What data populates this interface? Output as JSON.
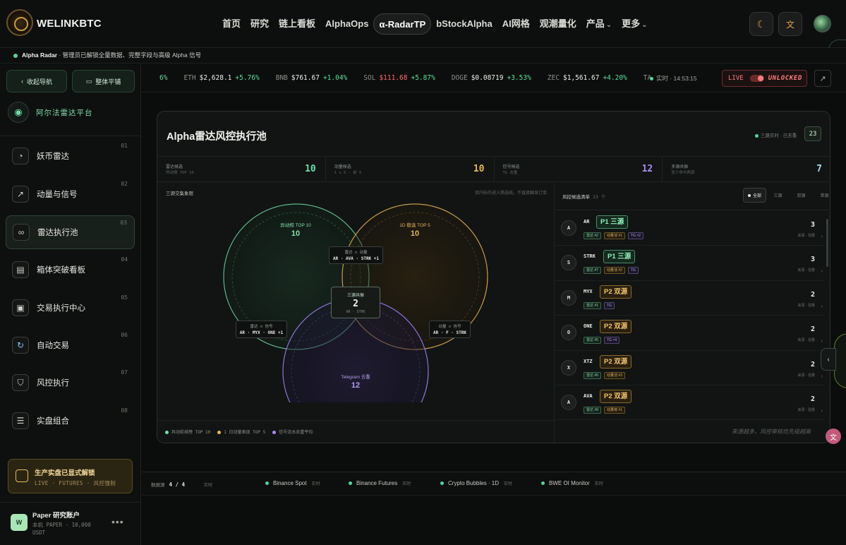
{
  "header": {
    "logo_text": "WELINKBTC",
    "nav": [
      "首页",
      "研究",
      "链上看板",
      "AlphaOps",
      "α-RadarTP",
      "bStockAlpha",
      "AI网格",
      "观潮量化",
      "产品",
      "更多"
    ],
    "active_nav": "α-RadarTP",
    "theme_icon": "moon-icon",
    "lang_icon": "translate-icon"
  },
  "announcement": {
    "label": "Alpha Radar",
    "text": " · 管理员已解锁全量数据、完整字段与高级 Alpha 信号"
  },
  "sidebar": {
    "collapse_label": "收起导航",
    "layout_label": "整体平铺",
    "brand": "阿尔法雷达平台",
    "items": [
      {
        "label": "妖币雷达",
        "num": "01",
        "icon": "gauge-icon"
      },
      {
        "label": "动量与信号",
        "num": "02",
        "icon": "trend-icon"
      },
      {
        "label": "雷达执行池",
        "num": "03",
        "icon": "venn-icon"
      },
      {
        "label": "箱体突破看板",
        "num": "04",
        "icon": "box-icon"
      },
      {
        "label": "交易执行中心",
        "num": "05",
        "icon": "target-icon"
      },
      {
        "label": "自动交易",
        "num": "06",
        "icon": "refresh-icon"
      },
      {
        "label": "风控执行",
        "num": "07",
        "icon": "shield-icon"
      },
      {
        "label": "实盘组合",
        "num": "08",
        "icon": "portfolio-icon"
      }
    ],
    "active_index": 2,
    "unlock": {
      "title": "生产实盘已显式解锁",
      "sub": "LIVE · FUTURES · 风控强制"
    },
    "account": {
      "avatar": "W",
      "name": "Paper 研究账户",
      "sub": "本机 PAPER · 10,000 USDT",
      "more": "•••"
    }
  },
  "ticker": {
    "items": [
      {
        "sym": "",
        "price": "",
        "chg": "6%"
      },
      {
        "sym": "ETH",
        "price": "$2,628.1",
        "chg": "+5.76%"
      },
      {
        "sym": "BNB",
        "price": "$761.67",
        "chg": "+1.04%"
      },
      {
        "sym": "SOL",
        "price": "$111.68",
        "chg": "+5.87%",
        "red_price": true
      },
      {
        "sym": "DOGE",
        "price": "$0.08719",
        "chg": "+3.53%"
      },
      {
        "sym": "ZEC",
        "price": "$1,561.67",
        "chg": "+4.20%"
      },
      {
        "sym": "TA",
        "price": "",
        "chg": ""
      }
    ],
    "status": "实时 · 14:53:15",
    "live": "LIVE",
    "unlocked": "UNLOCKED"
  },
  "panel": {
    "title": "Alpha雷达风控执行池",
    "meta": "三路实时 · 已去重",
    "count": "23",
    "stats": [
      {
        "t1": "雷达候选",
        "t2": "异动榜 TOP 10",
        "v": "10",
        "color": "#6fe0a7"
      },
      {
        "t1": "动量候选",
        "t2": "1 ∧ 5 · 前 5",
        "v": "10",
        "color": "#e8b65a"
      },
      {
        "t1": "信号候选",
        "t2": "TG 去重",
        "v": "12",
        "color": "#a98cf0"
      },
      {
        "t1": "多源共振",
        "t2": "至少命中两源",
        "v": "7",
        "color": "#9fd8f2"
      }
    ],
    "venn": {
      "label": "三源交集象限",
      "hint": "双内标的进入筛选线，不直接触发订单",
      "radar": {
        "name": "异动榜 TOP 10",
        "n": "10"
      },
      "momentum": {
        "name": "1D 稳选 TOP 5",
        "n": "10"
      },
      "signal": {
        "name": "Telegram 去重",
        "n": "12"
      },
      "rm": {
        "t": "雷达 ∩ 动量",
        "v": "AR · AVA · STRK +1"
      },
      "rs": {
        "t": "雷达 ∩ 信号",
        "v": "AR · MYX · ONE +1"
      },
      "ms": {
        "t": "动量 ∩ 信号",
        "v": "AR · F · STRK"
      },
      "center": {
        "t": "三源共振",
        "n": "2",
        "v": "AR · STRK"
      }
    },
    "legend": [
      "异动前排榜 TOP 10",
      "1 日动量表现 TOP 5",
      "信号流水去重平均"
    ],
    "list": {
      "title": "风控候选清单",
      "count": "23 个",
      "filters": [
        "全部",
        "三源",
        "双源",
        "单源"
      ],
      "rows": [
        {
          "av": "A",
          "sym": "AR",
          "pri": "P1 三源",
          "p": "p1",
          "tags": [
            [
              "雷达 #2",
              "g"
            ],
            [
              "动量池 #1",
              "y"
            ],
            [
              "TG ×2",
              "p"
            ]
          ],
          "score": "3",
          "sub": "来源 · 强量"
        },
        {
          "av": "S",
          "sym": "STRK",
          "pri": "P1 三源",
          "p": "p1",
          "tags": [
            [
              "雷达 #7",
              "g"
            ],
            [
              "动量池 #2",
              "y"
            ],
            [
              "TG",
              "p"
            ]
          ],
          "score": "3",
          "sub": "来源 · 强量"
        },
        {
          "av": "M",
          "sym": "MYX",
          "pri": "P2 双源",
          "p": "p2",
          "tags": [
            [
              "雷达 #1",
              "g"
            ],
            [
              "TG",
              "p"
            ]
          ],
          "score": "2",
          "sub": "来源 · 强量"
        },
        {
          "av": "O",
          "sym": "ONE",
          "pri": "P2 双源",
          "p": "p2",
          "tags": [
            [
              "雷达 #5",
              "g"
            ],
            [
              "TG ×4",
              "p"
            ]
          ],
          "score": "2",
          "sub": "来源 · 强量"
        },
        {
          "av": "X",
          "sym": "XTZ",
          "pri": "P2 双源",
          "p": "p2",
          "tags": [
            [
              "雷达 #6",
              "g"
            ],
            [
              "动量池 #3",
              "y"
            ]
          ],
          "score": "2",
          "sub": "来源 · 强量"
        },
        {
          "av": "A",
          "sym": "AVA",
          "pri": "P2 双源",
          "p": "p2",
          "tags": [
            [
              "雷达 #9",
              "g"
            ],
            [
              "动量榜 #1",
              "y"
            ]
          ],
          "score": "2",
          "sub": "来源 · 强量"
        }
      ]
    },
    "footer_italic": "来源越多，风控审核优先级越高"
  },
  "statusbar": {
    "ds_label": "数据源",
    "ds_value": "4 / 4",
    "first_rt": "实时",
    "feeds": [
      {
        "name": "Binance Spot",
        "rt": "实时"
      },
      {
        "name": "Binance Futures",
        "rt": "实时"
      },
      {
        "name": "Crypto Bubbles · 1D",
        "rt": "实时"
      },
      {
        "name": "BWE OI Monitor",
        "rt": "实时"
      }
    ]
  },
  "colors": {
    "accent": "#55d49a",
    "radar": "#6fe0a7",
    "momentum": "#e8b65a",
    "signal": "#a98cf0",
    "danger": "#ff6b6b"
  }
}
